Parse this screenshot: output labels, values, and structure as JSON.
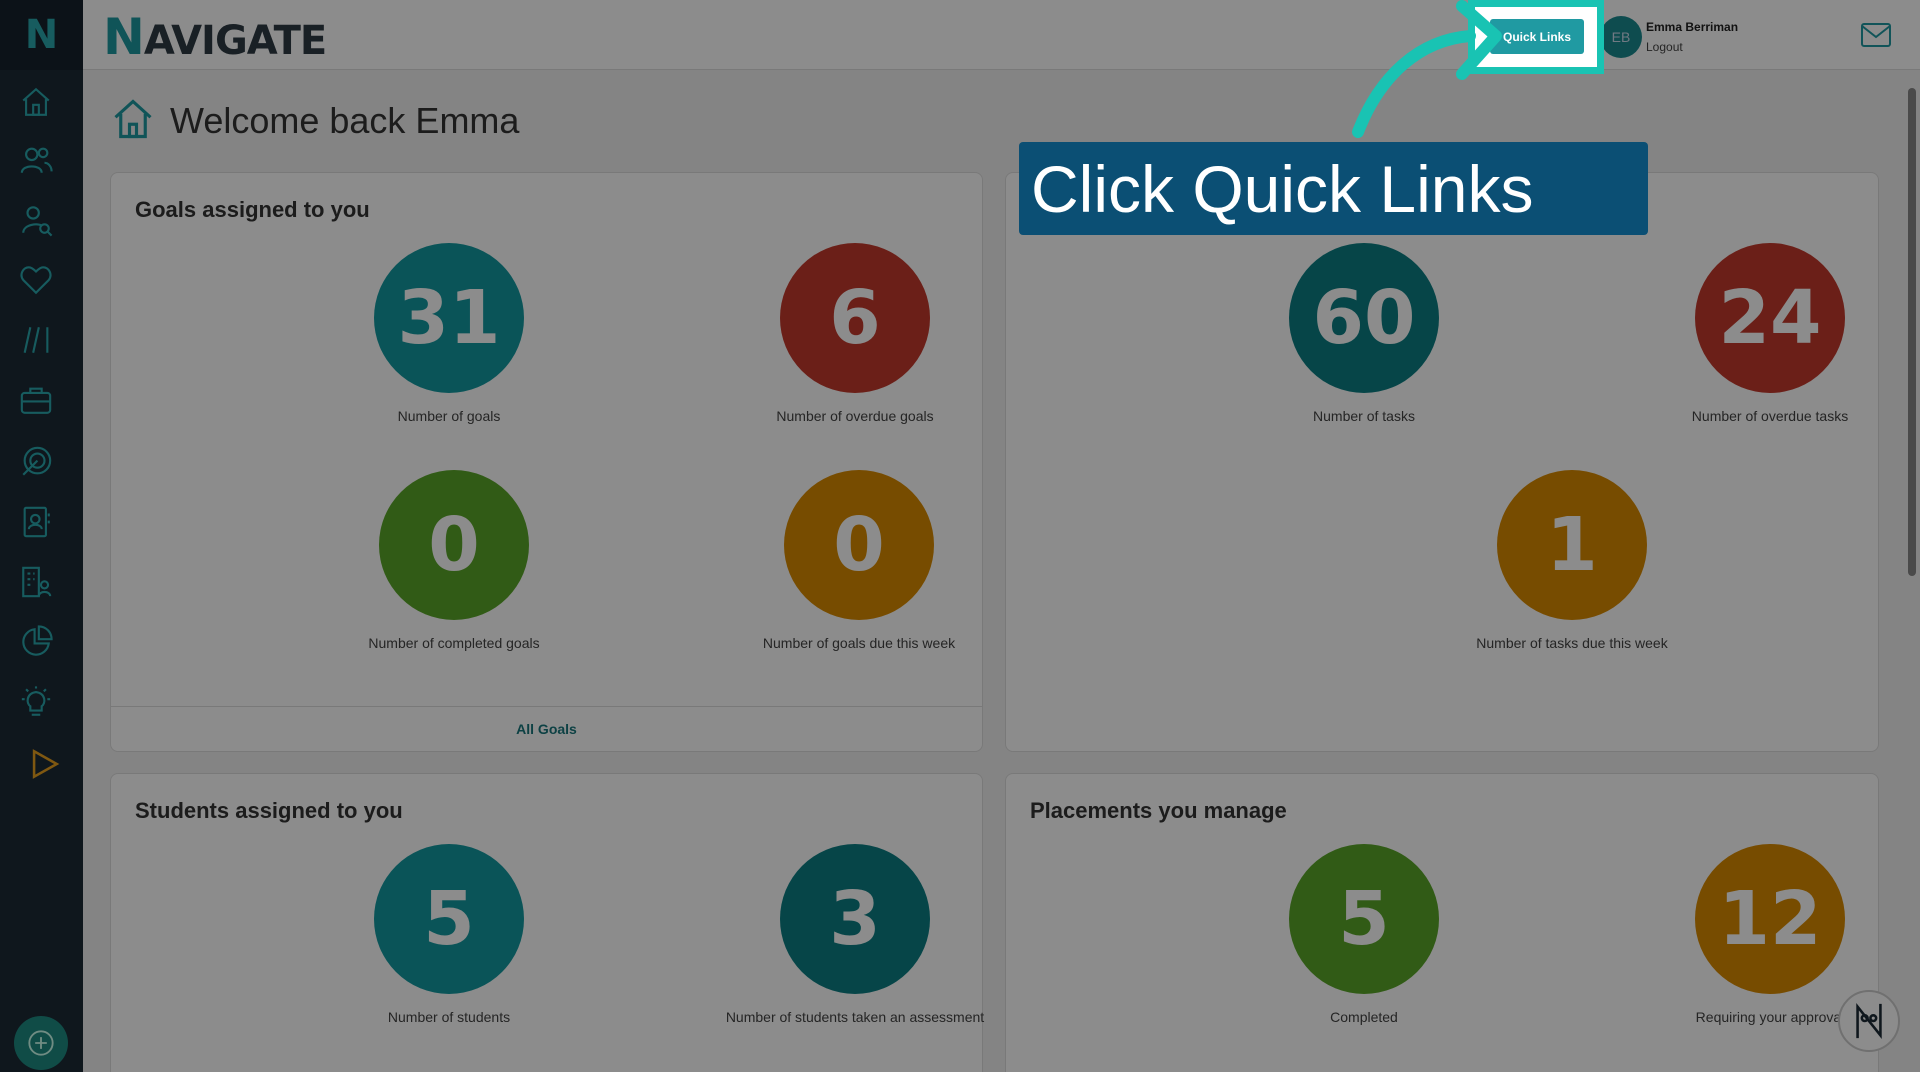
{
  "sidebar": {
    "logo": "N",
    "icons": [
      "home-icon",
      "users-icon",
      "user-search-icon",
      "heart-icon",
      "slashes-icon",
      "briefcase-icon",
      "target-icon",
      "contacts-icon",
      "building-user-icon",
      "pie-chart-icon",
      "lightbulb-icon",
      "play-icon"
    ],
    "plus_icon": "plus-circle-icon"
  },
  "header": {
    "brand_first": "N",
    "brand_rest": "AVIGATE",
    "quick_links": "Quick Links",
    "avatar_initials": "EB",
    "user_name": "Emma Berriman",
    "logout": "Logout",
    "mail_icon": "mail-icon"
  },
  "page": {
    "title": "Welcome back Emma"
  },
  "cards": {
    "goals": {
      "title": "Goals assigned to you",
      "stats": [
        {
          "value": "31",
          "label": "Number of goals"
        },
        {
          "value": "6",
          "label": "Number of overdue goals"
        },
        {
          "value": "0",
          "label": "Number of completed goals"
        },
        {
          "value": "0",
          "label": "Number of goals due this week"
        }
      ],
      "footer": "All Goals"
    },
    "tasks": {
      "stats": [
        {
          "value": "60",
          "label": "Number of tasks"
        },
        {
          "value": "24",
          "label": "Number of overdue tasks"
        },
        {
          "value": "1",
          "label": "Number of tasks due this week"
        }
      ]
    },
    "students": {
      "title": "Students assigned to you",
      "stats": [
        {
          "value": "5",
          "label": "Number of students"
        },
        {
          "value": "3",
          "label": "Number of students taken an assessment"
        }
      ]
    },
    "placements": {
      "title": "Placements you manage",
      "stats": [
        {
          "value": "5",
          "label": "Completed"
        },
        {
          "value": "12",
          "label": "Requiring your approval"
        }
      ]
    }
  },
  "overlay": {
    "callout": "Click Quick Links"
  },
  "colors": {
    "teal": "#139aa0",
    "red": "#c43a2c",
    "green": "#5aa628",
    "orange": "#d98a00",
    "highlight": "#19c3b3",
    "callout_bg": "#0b4f74"
  }
}
